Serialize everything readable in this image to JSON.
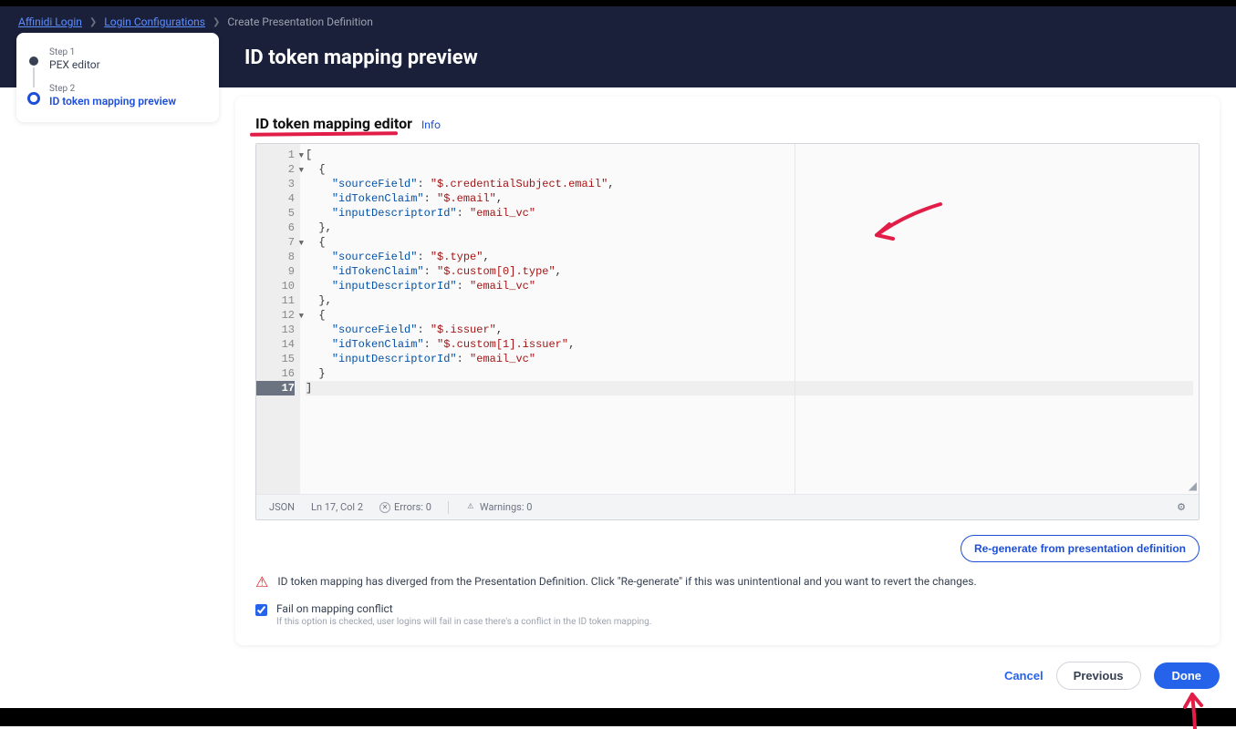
{
  "breadcrumb": {
    "link1": "Affinidi Login",
    "link2": "Login Configurations",
    "current": "Create Presentation Definition"
  },
  "page_title": "ID token mapping preview",
  "steps": [
    {
      "label": "Step 1",
      "name": "PEX editor"
    },
    {
      "label": "Step 2",
      "name": "ID token mapping preview"
    }
  ],
  "card": {
    "title": "ID token mapping editor",
    "info": "Info"
  },
  "code": {
    "lines": [
      {
        "n": 1,
        "fold": true,
        "tokens": [
          {
            "c": "p",
            "t": "["
          }
        ]
      },
      {
        "n": 2,
        "fold": true,
        "tokens": [
          {
            "c": "p",
            "t": "  {"
          }
        ]
      },
      {
        "n": 3,
        "tokens": [
          {
            "c": "p",
            "t": "    "
          },
          {
            "c": "k",
            "t": "\"sourceField\""
          },
          {
            "c": "p",
            "t": ": "
          },
          {
            "c": "s",
            "t": "\"$.credentialSubject.email\""
          },
          {
            "c": "p",
            "t": ","
          }
        ]
      },
      {
        "n": 4,
        "tokens": [
          {
            "c": "p",
            "t": "    "
          },
          {
            "c": "k",
            "t": "\"idTokenClaim\""
          },
          {
            "c": "p",
            "t": ": "
          },
          {
            "c": "s",
            "t": "\"$.email\""
          },
          {
            "c": "p",
            "t": ","
          }
        ]
      },
      {
        "n": 5,
        "tokens": [
          {
            "c": "p",
            "t": "    "
          },
          {
            "c": "k",
            "t": "\"inputDescriptorId\""
          },
          {
            "c": "p",
            "t": ": "
          },
          {
            "c": "s",
            "t": "\"email_vc\""
          }
        ]
      },
      {
        "n": 6,
        "tokens": [
          {
            "c": "p",
            "t": "  },"
          }
        ]
      },
      {
        "n": 7,
        "fold": true,
        "tokens": [
          {
            "c": "p",
            "t": "  {"
          }
        ]
      },
      {
        "n": 8,
        "tokens": [
          {
            "c": "p",
            "t": "    "
          },
          {
            "c": "k",
            "t": "\"sourceField\""
          },
          {
            "c": "p",
            "t": ": "
          },
          {
            "c": "s",
            "t": "\"$.type\""
          },
          {
            "c": "p",
            "t": ","
          }
        ]
      },
      {
        "n": 9,
        "tokens": [
          {
            "c": "p",
            "t": "    "
          },
          {
            "c": "k",
            "t": "\"idTokenClaim\""
          },
          {
            "c": "p",
            "t": ": "
          },
          {
            "c": "s",
            "t": "\"$.custom[0].type\""
          },
          {
            "c": "p",
            "t": ","
          }
        ]
      },
      {
        "n": 10,
        "tokens": [
          {
            "c": "p",
            "t": "    "
          },
          {
            "c": "k",
            "t": "\"inputDescriptorId\""
          },
          {
            "c": "p",
            "t": ": "
          },
          {
            "c": "s",
            "t": "\"email_vc\""
          }
        ]
      },
      {
        "n": 11,
        "tokens": [
          {
            "c": "p",
            "t": "  },"
          }
        ]
      },
      {
        "n": 12,
        "fold": true,
        "tokens": [
          {
            "c": "p",
            "t": "  {"
          }
        ]
      },
      {
        "n": 13,
        "tokens": [
          {
            "c": "p",
            "t": "    "
          },
          {
            "c": "k",
            "t": "\"sourceField\""
          },
          {
            "c": "p",
            "t": ": "
          },
          {
            "c": "s",
            "t": "\"$.issuer\""
          },
          {
            "c": "p",
            "t": ","
          }
        ]
      },
      {
        "n": 14,
        "tokens": [
          {
            "c": "p",
            "t": "    "
          },
          {
            "c": "k",
            "t": "\"idTokenClaim\""
          },
          {
            "c": "p",
            "t": ": "
          },
          {
            "c": "s",
            "t": "\"$.custom[1].issuer\""
          },
          {
            "c": "p",
            "t": ","
          }
        ]
      },
      {
        "n": 15,
        "tokens": [
          {
            "c": "p",
            "t": "    "
          },
          {
            "c": "k",
            "t": "\"inputDescriptorId\""
          },
          {
            "c": "p",
            "t": ": "
          },
          {
            "c": "s",
            "t": "\"email_vc\""
          }
        ]
      },
      {
        "n": 16,
        "tokens": [
          {
            "c": "p",
            "t": "  }"
          }
        ]
      },
      {
        "n": 17,
        "current": true,
        "tokens": [
          {
            "c": "p",
            "t": "]"
          }
        ]
      }
    ]
  },
  "status": {
    "lang": "JSON",
    "pos": "Ln 17, Col 2",
    "errors": "Errors: 0",
    "warnings": "Warnings: 0"
  },
  "regenerate": "Re-generate from presentation definition",
  "alert_text": "ID token mapping has diverged from the Presentation Definition. Click \"Re-generate\" if this was unintentional and you want to revert the changes.",
  "checkbox": {
    "title": "Fail on mapping conflict",
    "sub": "If this option is checked, user logins will fail in case there's a conflict in the ID token mapping."
  },
  "buttons": {
    "cancel": "Cancel",
    "previous": "Previous",
    "done": "Done"
  }
}
